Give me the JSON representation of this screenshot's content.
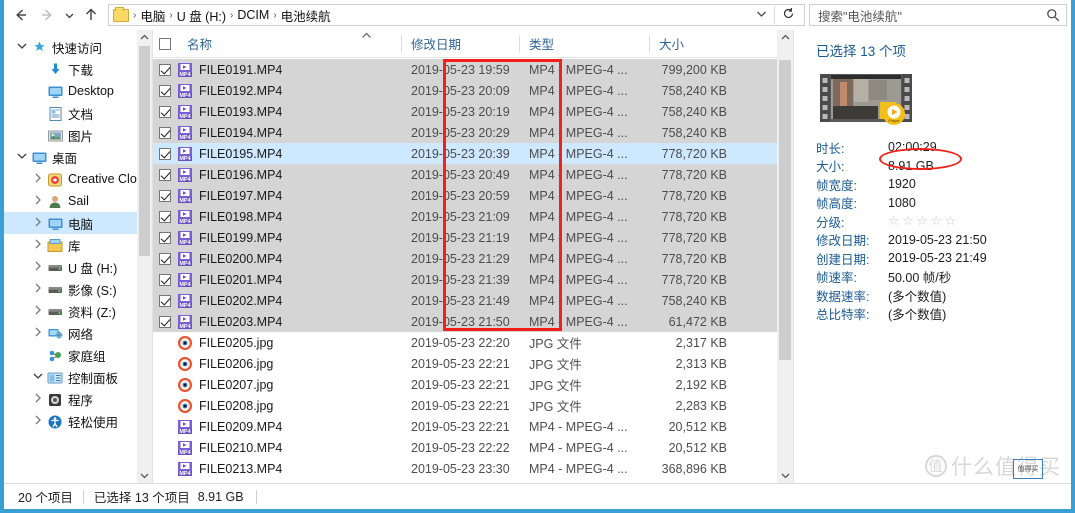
{
  "window": {
    "accent_color": "#3a9fd4"
  },
  "nav": {
    "back_icon": "arrow-left-icon",
    "forward_icon": "arrow-right-icon",
    "recent_icon": "chevron-down-icon",
    "up_icon": "arrow-up-icon",
    "breadcrumbs": [
      "电脑",
      "U 盘 (H:)",
      "DCIM",
      "电池续航"
    ],
    "separator": "›",
    "dropdown_icon": "chevron-down-icon",
    "refresh_icon": "refresh-icon"
  },
  "search": {
    "placeholder": "搜索\"电池续航\"",
    "icon": "search-icon"
  },
  "sidebar": {
    "items": [
      {
        "label": "快速访问",
        "icon": "star-pin-icon",
        "indent": 0,
        "chevron": "open",
        "selected": false,
        "pin": ""
      },
      {
        "label": "下载",
        "icon": "download-icon",
        "indent": 1,
        "chevron": "none",
        "selected": false,
        "pin": "pin-icon"
      },
      {
        "label": "Desktop",
        "icon": "desktop-icon",
        "indent": 1,
        "chevron": "none",
        "selected": false,
        "pin": "pin-icon"
      },
      {
        "label": "文档",
        "icon": "documents-icon",
        "indent": 1,
        "chevron": "none",
        "selected": false,
        "pin": "pin-icon"
      },
      {
        "label": "图片",
        "icon": "pictures-icon",
        "indent": 1,
        "chevron": "none",
        "selected": false,
        "pin": "pin-icon"
      },
      {
        "label": "桌面",
        "icon": "desktop-icon",
        "indent": 0,
        "chevron": "open",
        "selected": false,
        "pin": ""
      },
      {
        "label": "Creative Cloud",
        "icon": "creative-cloud-icon",
        "indent": 2,
        "chevron": "closed",
        "selected": false,
        "pin": ""
      },
      {
        "label": "Sail",
        "icon": "user-icon",
        "indent": 2,
        "chevron": "closed",
        "selected": false,
        "pin": ""
      },
      {
        "label": "电脑",
        "icon": "computer-icon",
        "indent": 2,
        "chevron": "closed",
        "selected": true,
        "pin": ""
      },
      {
        "label": "库",
        "icon": "library-icon",
        "indent": 2,
        "chevron": "closed",
        "selected": false,
        "pin": ""
      },
      {
        "label": "U 盘 (H:)",
        "icon": "drive-icon",
        "indent": 2,
        "chevron": "closed",
        "selected": false,
        "pin": ""
      },
      {
        "label": "影像 (S:)",
        "icon": "drive-icon",
        "indent": 2,
        "chevron": "closed",
        "selected": false,
        "pin": ""
      },
      {
        "label": "资料 (Z:)",
        "icon": "drive-icon",
        "indent": 2,
        "chevron": "closed",
        "selected": false,
        "pin": ""
      },
      {
        "label": "网络",
        "icon": "network-icon",
        "indent": 2,
        "chevron": "closed",
        "selected": false,
        "pin": ""
      },
      {
        "label": "家庭组",
        "icon": "homegroup-icon",
        "indent": 2,
        "chevron": "none",
        "selected": false,
        "pin": ""
      },
      {
        "label": "控制面板",
        "icon": "control-panel-icon",
        "indent": 1,
        "chevron": "open",
        "selected": false,
        "pin": ""
      },
      {
        "label": "程序",
        "icon": "programs-icon",
        "indent": 2,
        "chevron": "closed",
        "selected": false,
        "pin": ""
      },
      {
        "label": "轻松使用",
        "icon": "ease-of-access-icon",
        "indent": 2,
        "chevron": "closed",
        "selected": false,
        "pin": ""
      }
    ]
  },
  "filelist": {
    "columns": [
      "名称",
      "修改日期",
      "类型",
      "大小"
    ],
    "select_all_checked": false,
    "sort_indicator": "ascending",
    "rows": [
      {
        "name": "FILE0191.MP4",
        "date": "2019-05-23 19:59",
        "type": "MP4 - MPEG-4 ...",
        "size": "799,200 KB",
        "icon": "mp4-file-icon",
        "checked": true,
        "state": "selected"
      },
      {
        "name": "FILE0192.MP4",
        "date": "2019-05-23 20:09",
        "type": "MP4 - MPEG-4 ...",
        "size": "758,240 KB",
        "icon": "mp4-file-icon",
        "checked": true,
        "state": "selected"
      },
      {
        "name": "FILE0193.MP4",
        "date": "2019-05-23 20:19",
        "type": "MP4 - MPEG-4 ...",
        "size": "758,240 KB",
        "icon": "mp4-file-icon",
        "checked": true,
        "state": "selected"
      },
      {
        "name": "FILE0194.MP4",
        "date": "2019-05-23 20:29",
        "type": "MP4 - MPEG-4 ...",
        "size": "758,240 KB",
        "icon": "mp4-file-icon",
        "checked": true,
        "state": "selected"
      },
      {
        "name": "FILE0195.MP4",
        "date": "2019-05-23 20:39",
        "type": "MP4 - MPEG-4 ...",
        "size": "778,720 KB",
        "icon": "mp4-file-icon",
        "checked": true,
        "state": "focused"
      },
      {
        "name": "FILE0196.MP4",
        "date": "2019-05-23 20:49",
        "type": "MP4 - MPEG-4 ...",
        "size": "778,720 KB",
        "icon": "mp4-file-icon",
        "checked": true,
        "state": "selected"
      },
      {
        "name": "FILE0197.MP4",
        "date": "2019-05-23 20:59",
        "type": "MP4 - MPEG-4 ...",
        "size": "778,720 KB",
        "icon": "mp4-file-icon",
        "checked": true,
        "state": "selected"
      },
      {
        "name": "FILE0198.MP4",
        "date": "2019-05-23 21:09",
        "type": "MP4 - MPEG-4 ...",
        "size": "778,720 KB",
        "icon": "mp4-file-icon",
        "checked": true,
        "state": "selected"
      },
      {
        "name": "FILE0199.MP4",
        "date": "2019-05-23 21:19",
        "type": "MP4 - MPEG-4 ...",
        "size": "778,720 KB",
        "icon": "mp4-file-icon",
        "checked": true,
        "state": "selected"
      },
      {
        "name": "FILE0200.MP4",
        "date": "2019-05-23 21:29",
        "type": "MP4 - MPEG-4 ...",
        "size": "778,720 KB",
        "icon": "mp4-file-icon",
        "checked": true,
        "state": "selected"
      },
      {
        "name": "FILE0201.MP4",
        "date": "2019-05-23 21:39",
        "type": "MP4 - MPEG-4 ...",
        "size": "778,720 KB",
        "icon": "mp4-file-icon",
        "checked": true,
        "state": "selected"
      },
      {
        "name": "FILE0202.MP4",
        "date": "2019-05-23 21:49",
        "type": "MP4 - MPEG-4 ...",
        "size": "758,240 KB",
        "icon": "mp4-file-icon",
        "checked": true,
        "state": "selected"
      },
      {
        "name": "FILE0203.MP4",
        "date": "2019-05-23 21:50",
        "type": "MP4 - MPEG-4 ...",
        "size": "61,472 KB",
        "icon": "mp4-file-icon",
        "checked": true,
        "state": "selected"
      },
      {
        "name": "FILE0205.jpg",
        "date": "2019-05-23 22:20",
        "type": "JPG 文件",
        "size": "2,317 KB",
        "icon": "jpg-file-icon",
        "checked": false,
        "state": "normal"
      },
      {
        "name": "FILE0206.jpg",
        "date": "2019-05-23 22:21",
        "type": "JPG 文件",
        "size": "2,313 KB",
        "icon": "jpg-file-icon",
        "checked": false,
        "state": "normal"
      },
      {
        "name": "FILE0207.jpg",
        "date": "2019-05-23 22:21",
        "type": "JPG 文件",
        "size": "2,192 KB",
        "icon": "jpg-file-icon",
        "checked": false,
        "state": "normal"
      },
      {
        "name": "FILE0208.jpg",
        "date": "2019-05-23 22:21",
        "type": "JPG 文件",
        "size": "2,283 KB",
        "icon": "jpg-file-icon",
        "checked": false,
        "state": "normal"
      },
      {
        "name": "FILE0209.MP4",
        "date": "2019-05-23 22:21",
        "type": "MP4 - MPEG-4 ...",
        "size": "20,512 KB",
        "icon": "mp4-file-icon",
        "checked": false,
        "state": "normal"
      },
      {
        "name": "FILE0210.MP4",
        "date": "2019-05-23 22:22",
        "type": "MP4 - MPEG-4 ...",
        "size": "20,512 KB",
        "icon": "mp4-file-icon",
        "checked": false,
        "state": "normal"
      },
      {
        "name": "FILE0213.MP4",
        "date": "2019-05-23 23:30",
        "type": "MP4 - MPEG-4 ...",
        "size": "368,896 KB",
        "icon": "mp4-file-icon",
        "checked": false,
        "state": "normal"
      }
    ]
  },
  "details": {
    "title": "已选择 13 个项",
    "thumbnail": "video-filmstrip-thumbnail",
    "properties": [
      {
        "key": "时长:",
        "value": "02:00:29",
        "type": "text"
      },
      {
        "key": "大小:",
        "value": "8.91 GB",
        "type": "text"
      },
      {
        "key": "帧宽度:",
        "value": "1920",
        "type": "text"
      },
      {
        "key": "帧高度:",
        "value": "1080",
        "type": "text"
      },
      {
        "key": "分级:",
        "value": "☆☆☆☆☆",
        "type": "stars"
      },
      {
        "key": "修改日期:",
        "value": "2019-05-23 21:50",
        "type": "text"
      },
      {
        "key": "创建日期:",
        "value": "2019-05-23 21:49",
        "type": "text"
      },
      {
        "key": "帧速率:",
        "value": "50.00 帧/秒",
        "type": "text"
      },
      {
        "key": "数据速率:",
        "value": "(多个数值)",
        "type": "text"
      },
      {
        "key": "总比特率:",
        "value": "(多个数值)",
        "type": "text"
      }
    ]
  },
  "statusbar": {
    "item_count": "20 个项目",
    "selected_count": "已选择 13 个项目",
    "selected_size": "8.91 GB"
  },
  "annotations": {
    "color": "#f22018",
    "date_column_box": "red-rectangle-highlight",
    "duration_oval": "red-oval-highlight"
  },
  "watermark": {
    "text": "什么值得买",
    "logo": "值"
  }
}
